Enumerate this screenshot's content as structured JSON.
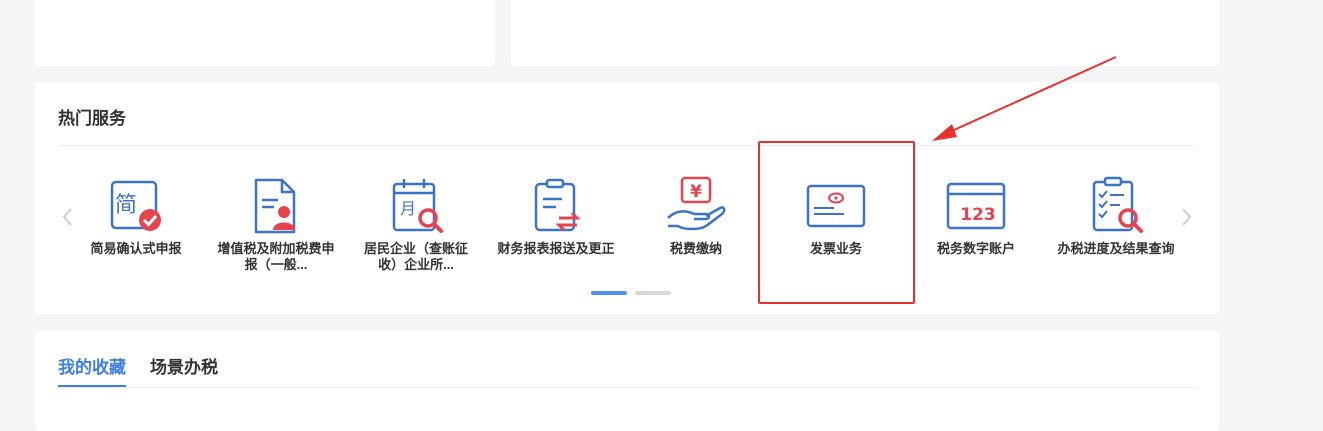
{
  "hot_services": {
    "title": "热门服务",
    "items": [
      {
        "label": "简易确认式申报",
        "icon": "simple-confirm-icon",
        "icon_text": "简"
      },
      {
        "label": "增值税及附加税费申报（一般...",
        "icon": "vat-declare-icon"
      },
      {
        "label": "居民企业（查账征收）企业所...",
        "icon": "enterprise-tax-icon",
        "icon_text": "月"
      },
      {
        "label": "财务报表报送及更正",
        "icon": "financial-report-icon"
      },
      {
        "label": "税费缴纳",
        "icon": "tax-payment-icon",
        "icon_text": "¥"
      },
      {
        "label": "发票业务",
        "icon": "invoice-icon"
      },
      {
        "label": "税务数字账户",
        "icon": "digital-account-icon",
        "icon_text": "123"
      },
      {
        "label": "办税进度及结果查询",
        "icon": "progress-query-icon"
      }
    ],
    "pagination": {
      "pages": 2,
      "current": 1
    }
  },
  "favorites": {
    "tabs": [
      {
        "label": "我的收藏",
        "active": true
      },
      {
        "label": "场景办税",
        "active": false
      }
    ]
  },
  "colors": {
    "accent_blue": "#3d7fe6",
    "icon_blue": "#3b73c9",
    "icon_red": "#e8424f",
    "annotation_red": "#e8312f"
  }
}
